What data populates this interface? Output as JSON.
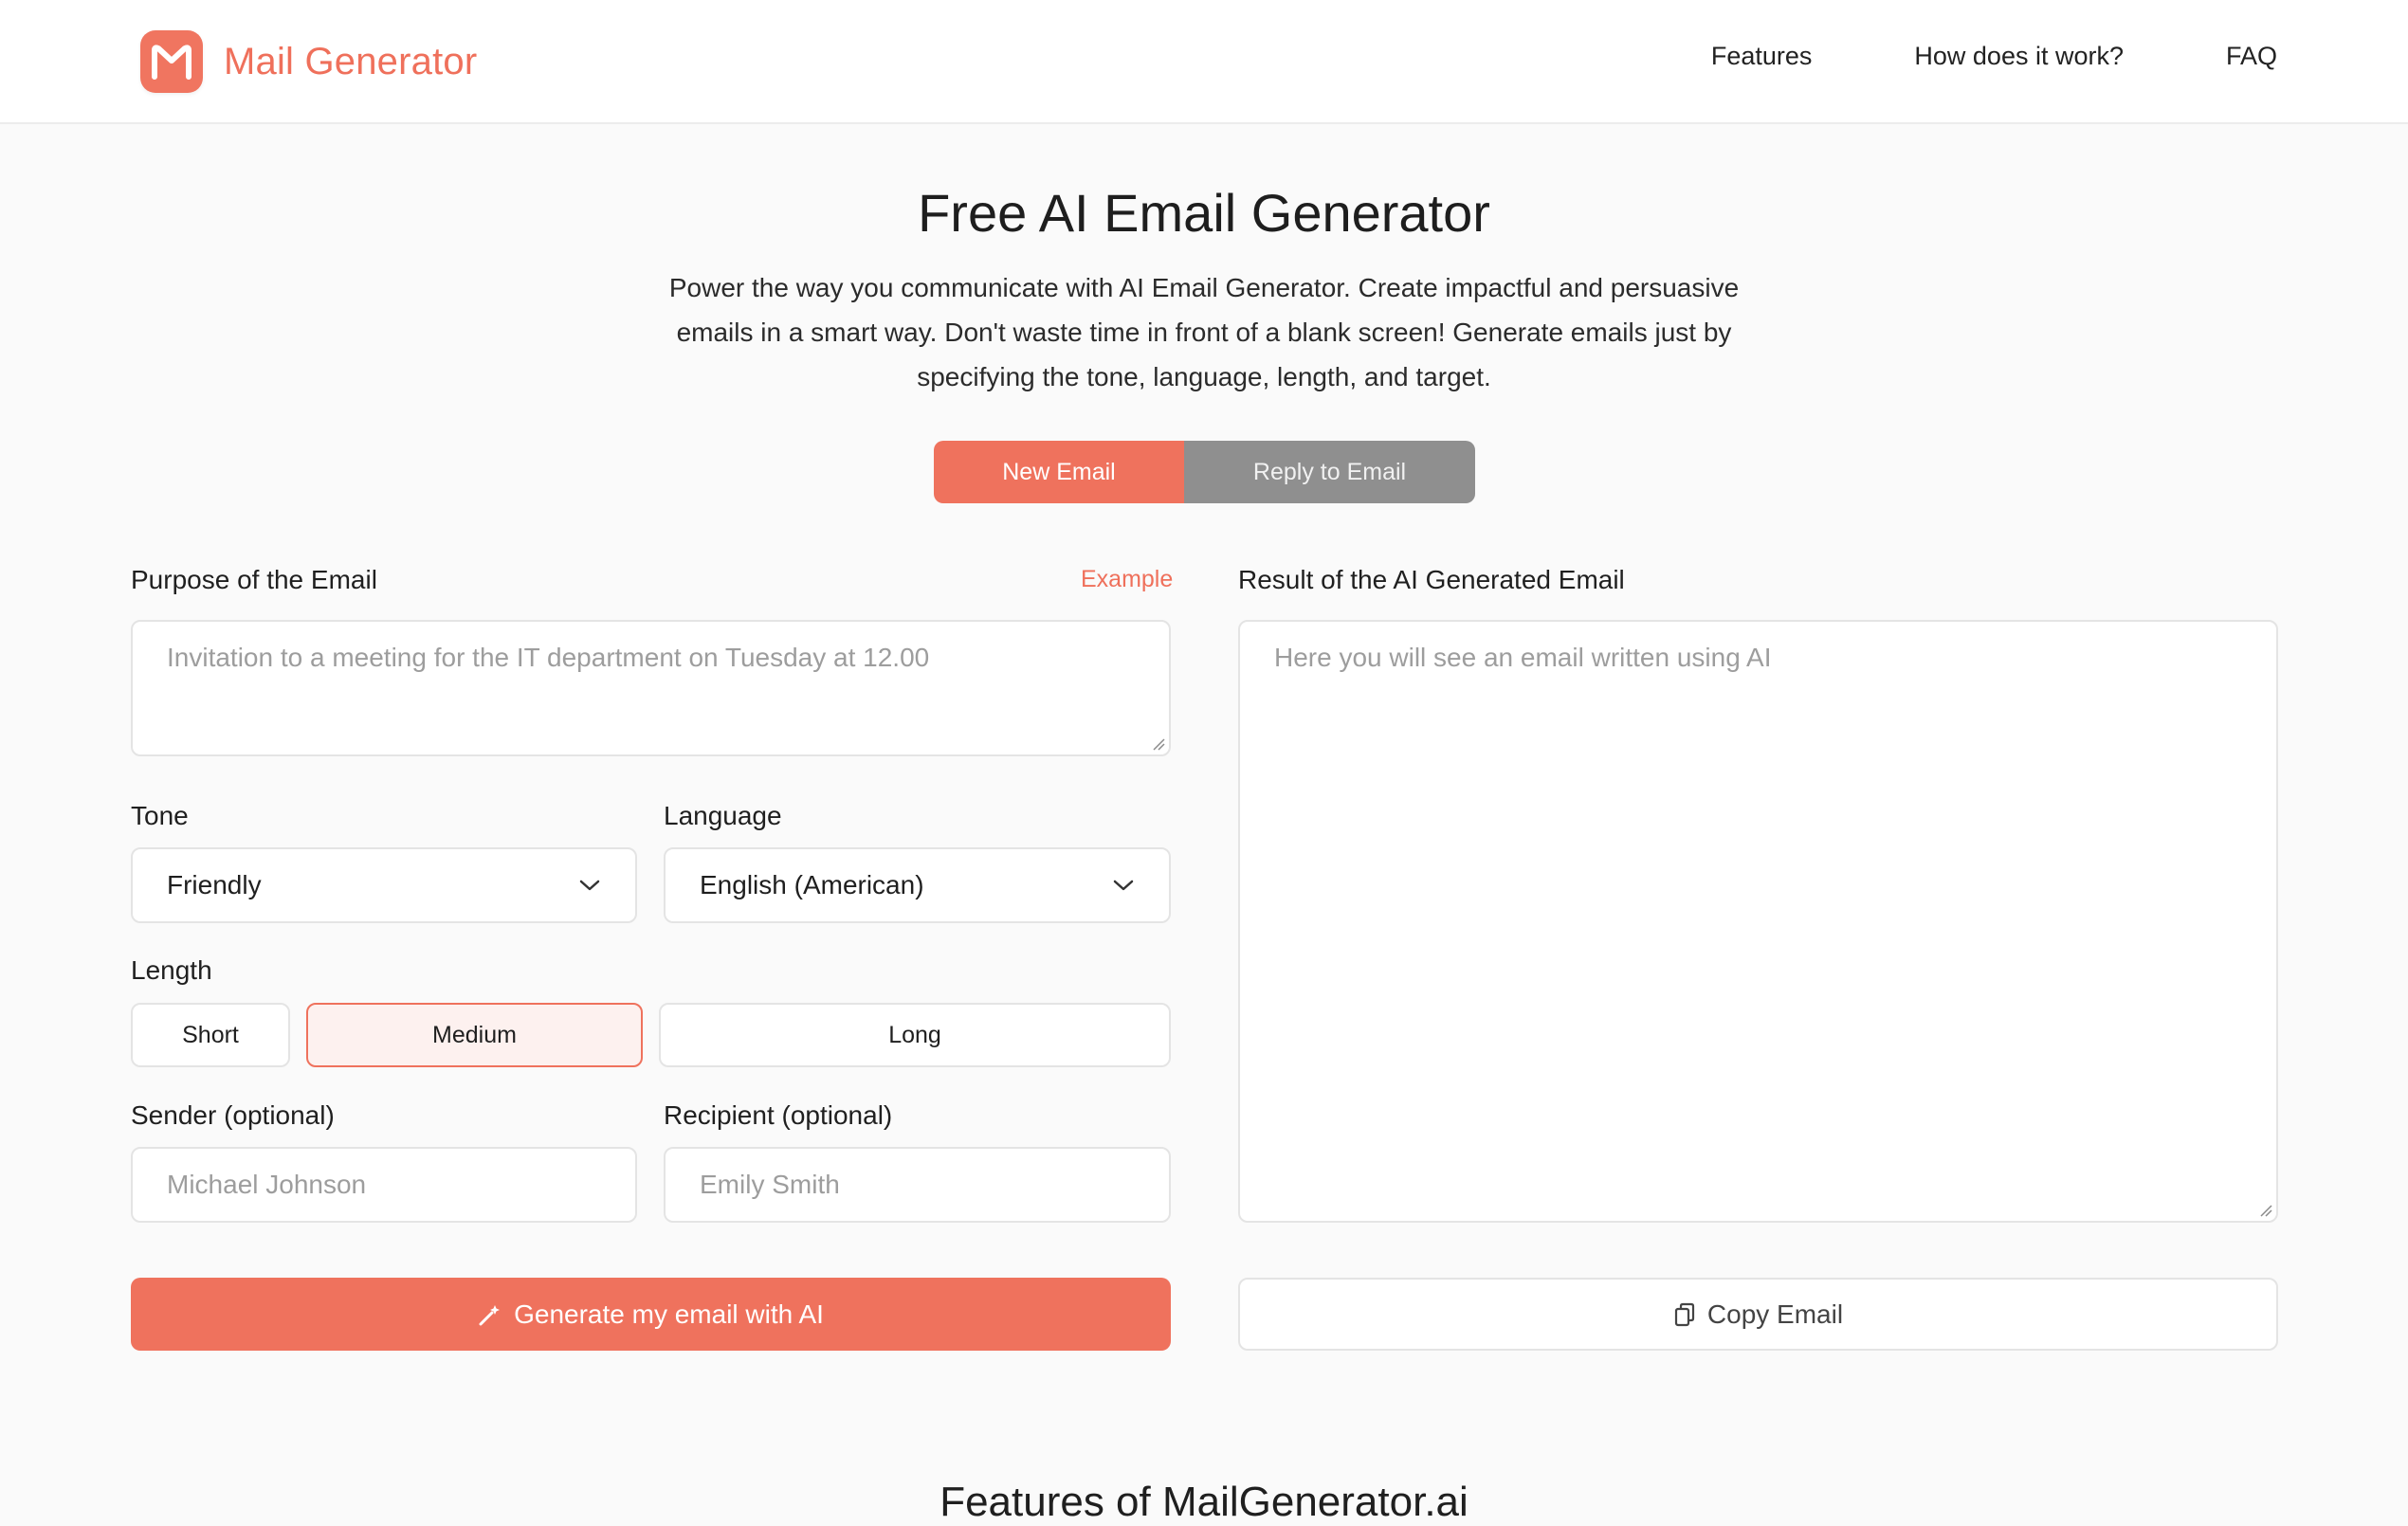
{
  "header": {
    "brand": "Mail Generator",
    "logo_icon": "mail-m-icon",
    "brand_color": "#ef705b",
    "nav": [
      {
        "label": "Features"
      },
      {
        "label": "How does it work?"
      },
      {
        "label": "FAQ"
      }
    ]
  },
  "hero": {
    "title": "Free AI Email Generator",
    "description": "Power the way you communicate with AI Email Generator. Create impactful and persuasive emails in a smart way. Don't waste time in front of a blank screen! Generate emails just by specifying the tone, language, length, and target."
  },
  "mode_tabs": {
    "new_label": "New Email",
    "reply_label": "Reply to Email",
    "active": "New Email"
  },
  "form": {
    "purpose_label": "Purpose of the Email",
    "example_link": "Example",
    "purpose_placeholder": "Invitation to a meeting for the IT department on Tuesday at 12.00",
    "tone_label": "Tone",
    "tone_value": "Friendly",
    "language_label": "Language",
    "language_value": "English (American)",
    "length_label": "Length",
    "length_options": [
      {
        "label": "Short"
      },
      {
        "label": "Medium"
      },
      {
        "label": "Long"
      }
    ],
    "length_selected": "Medium",
    "sender_label": "Sender (optional)",
    "sender_placeholder": "Michael Johnson",
    "recipient_label": "Recipient (optional)",
    "recipient_placeholder": "Emily Smith",
    "generate_label": "Generate my email with AI",
    "generate_icon": "magic-wand-icon"
  },
  "result": {
    "label": "Result of the AI Generated Email",
    "placeholder": "Here you will see an email written using AI",
    "copy_label": "Copy Email",
    "copy_icon": "copy-icon"
  },
  "features": {
    "heading": "Features of MailGenerator.ai"
  },
  "colors": {
    "accent": "#ef725d",
    "inactive_tab": "#8f8f8f",
    "selected_fill": "#fdf1ef"
  }
}
